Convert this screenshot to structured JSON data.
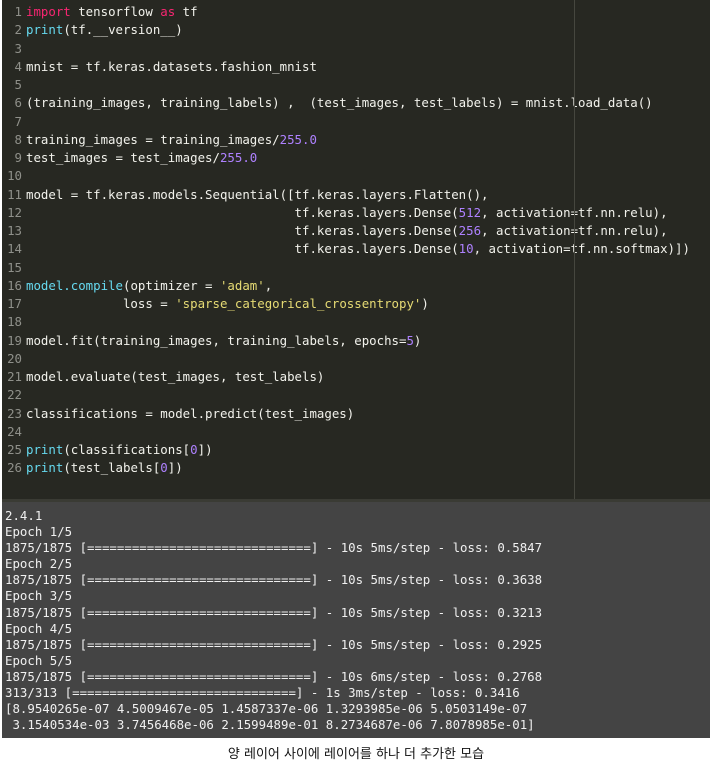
{
  "editor": {
    "lines": [
      {
        "n": "1",
        "tokens": [
          {
            "t": "kw",
            "v": "import"
          },
          {
            "t": "plain",
            "v": " tensorflow "
          },
          {
            "t": "kw",
            "v": "as"
          },
          {
            "t": "plain",
            "v": " tf"
          }
        ]
      },
      {
        "n": "2",
        "tokens": [
          {
            "t": "fn",
            "v": "print"
          },
          {
            "t": "plain",
            "v": "(tf.__version__)"
          }
        ]
      },
      {
        "n": "3",
        "tokens": []
      },
      {
        "n": "4",
        "tokens": [
          {
            "t": "plain",
            "v": "mnist = tf.keras.datasets.fashion_mnist"
          }
        ]
      },
      {
        "n": "5",
        "tokens": []
      },
      {
        "n": "6",
        "tokens": [
          {
            "t": "plain",
            "v": "(training_images, training_labels) ,  (test_images, test_labels) = mnist.load_data()"
          }
        ]
      },
      {
        "n": "7",
        "tokens": []
      },
      {
        "n": "8",
        "tokens": [
          {
            "t": "plain",
            "v": "training_images = training_images/"
          },
          {
            "t": "num",
            "v": "255.0"
          }
        ]
      },
      {
        "n": "9",
        "tokens": [
          {
            "t": "plain",
            "v": "test_images = test_images/"
          },
          {
            "t": "num",
            "v": "255.0"
          }
        ]
      },
      {
        "n": "10",
        "tokens": []
      },
      {
        "n": "11",
        "tokens": [
          {
            "t": "plain",
            "v": "model = tf.keras.models.Sequential([tf.keras.layers.Flatten(),"
          }
        ]
      },
      {
        "n": "12",
        "tokens": [
          {
            "t": "plain",
            "v": "                                    tf.keras.layers.Dense("
          },
          {
            "t": "num",
            "v": "512"
          },
          {
            "t": "plain",
            "v": ", activation=tf.nn.relu),"
          }
        ]
      },
      {
        "n": "13",
        "tokens": [
          {
            "t": "plain",
            "v": "                                    tf.keras.layers.Dense("
          },
          {
            "t": "num",
            "v": "256"
          },
          {
            "t": "plain",
            "v": ", activation=tf.nn.relu),"
          }
        ]
      },
      {
        "n": "14",
        "tokens": [
          {
            "t": "plain",
            "v": "                                    tf.keras.layers.Dense("
          },
          {
            "t": "num",
            "v": "10"
          },
          {
            "t": "plain",
            "v": ", activation=tf.nn.softmax)])"
          }
        ]
      },
      {
        "n": "15",
        "tokens": []
      },
      {
        "n": "16",
        "tokens": [
          {
            "t": "fn",
            "v": "model.compile"
          },
          {
            "t": "plain",
            "v": "(optimizer = "
          },
          {
            "t": "str",
            "v": "'adam'"
          },
          {
            "t": "plain",
            "v": ","
          }
        ]
      },
      {
        "n": "17",
        "tokens": [
          {
            "t": "plain",
            "v": "             loss = "
          },
          {
            "t": "str",
            "v": "'sparse_categorical_crossentropy'"
          },
          {
            "t": "plain",
            "v": ")"
          }
        ]
      },
      {
        "n": "18",
        "tokens": []
      },
      {
        "n": "19",
        "tokens": [
          {
            "t": "plain",
            "v": "model.fit(training_images, training_labels, epochs="
          },
          {
            "t": "num",
            "v": "5"
          },
          {
            "t": "plain",
            "v": ")"
          }
        ]
      },
      {
        "n": "20",
        "tokens": []
      },
      {
        "n": "21",
        "tokens": [
          {
            "t": "plain",
            "v": "model.evaluate(test_images, test_labels)"
          }
        ]
      },
      {
        "n": "22",
        "tokens": []
      },
      {
        "n": "23",
        "tokens": [
          {
            "t": "plain",
            "v": "classifications = model.predict(test_images)"
          }
        ]
      },
      {
        "n": "24",
        "tokens": []
      },
      {
        "n": "25",
        "tokens": [
          {
            "t": "fn",
            "v": "print"
          },
          {
            "t": "plain",
            "v": "(classifications["
          },
          {
            "t": "num",
            "v": "0"
          },
          {
            "t": "plain",
            "v": "])"
          }
        ]
      },
      {
        "n": "26",
        "tokens": [
          {
            "t": "fn",
            "v": "print"
          },
          {
            "t": "plain",
            "v": "(test_labels["
          },
          {
            "t": "num",
            "v": "0"
          },
          {
            "t": "plain",
            "v": "])"
          }
        ]
      }
    ]
  },
  "console": {
    "lines": [
      "2.4.1",
      "Epoch 1/5",
      "1875/1875 [==============================] - 10s 5ms/step - loss: 0.5847",
      "Epoch 2/5",
      "1875/1875 [==============================] - 10s 5ms/step - loss: 0.3638",
      "Epoch 3/5",
      "1875/1875 [==============================] - 10s 5ms/step - loss: 0.3213",
      "Epoch 4/5",
      "1875/1875 [==============================] - 10s 5ms/step - loss: 0.2925",
      "Epoch 5/5",
      "1875/1875 [==============================] - 10s 6ms/step - loss: 0.2768",
      "313/313 [==============================] - 1s 3ms/step - loss: 0.3416",
      "[8.9540265e-07 4.5009467e-05 1.4587337e-06 1.3293985e-06 5.0503149e-07",
      " 3.1540534e-03 3.7456468e-06 2.1599489e-01 8.2734687e-06 7.8078985e-01]"
    ]
  },
  "caption": "양 레이어 사이에 레이어를 하나 더 추가한 모습",
  "colors": {
    "editor_bg": "#272822",
    "console_bg": "#444444",
    "keyword": "#f92672",
    "builtin": "#66d9ef",
    "number": "#ae81ff",
    "string": "#e6db74"
  }
}
